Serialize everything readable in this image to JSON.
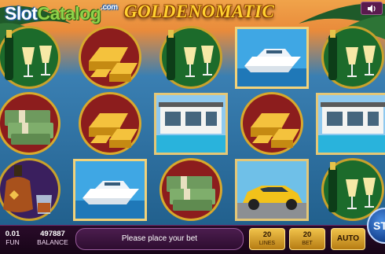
{
  "watermark": {
    "part1": "Slot",
    "part2": "Catalog",
    "part3": ".com"
  },
  "game_title": "GOLDENOMATIC",
  "sound": {
    "icon": "speaker-icon"
  },
  "reels": [
    [
      "champagne",
      "money",
      "cognac"
    ],
    [
      "gold",
      "gold",
      "yacht"
    ],
    [
      "champagne",
      "villa",
      "money"
    ],
    [
      "yacht",
      "gold",
      "car"
    ],
    [
      "champagne",
      "villa",
      "champagne"
    ]
  ],
  "bottom_bar": {
    "coin_value": "0.01",
    "coin_label": "FUN",
    "balance_value": "497887",
    "balance_label": "BALANCE",
    "message": "Please place your bet",
    "lines_value": "20",
    "lines_label": "LINES",
    "bet_value": "20",
    "bet_label": "BET",
    "auto_label": "AUTO",
    "spin_label": "ST"
  },
  "colors": {
    "gold": "#f2b21c",
    "bar_bg": "#1e0820",
    "button_gold": "#e0a52e"
  }
}
